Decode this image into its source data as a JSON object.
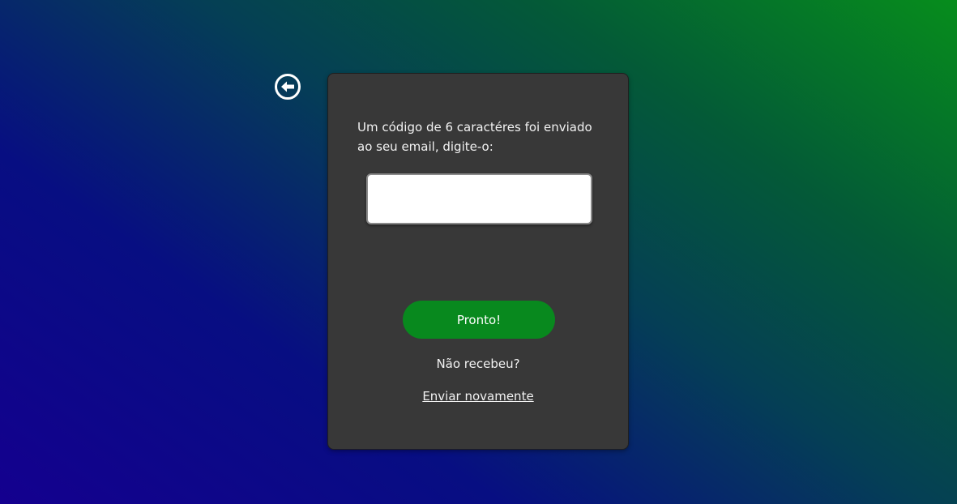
{
  "back": {
    "icon": "arrow-left-circle-icon"
  },
  "card": {
    "message": "Um código de 6 caractéres foi enviado ao seu email, digite-o:",
    "code_input": {
      "value": "",
      "placeholder": ""
    },
    "done_label": "Pronto!",
    "not_received_text": "Não recebeu?",
    "resend_label": "Enviar novamente"
  },
  "colors": {
    "card_background": "#383838",
    "button_green": "#08891e",
    "text": "#f2f2f2"
  }
}
